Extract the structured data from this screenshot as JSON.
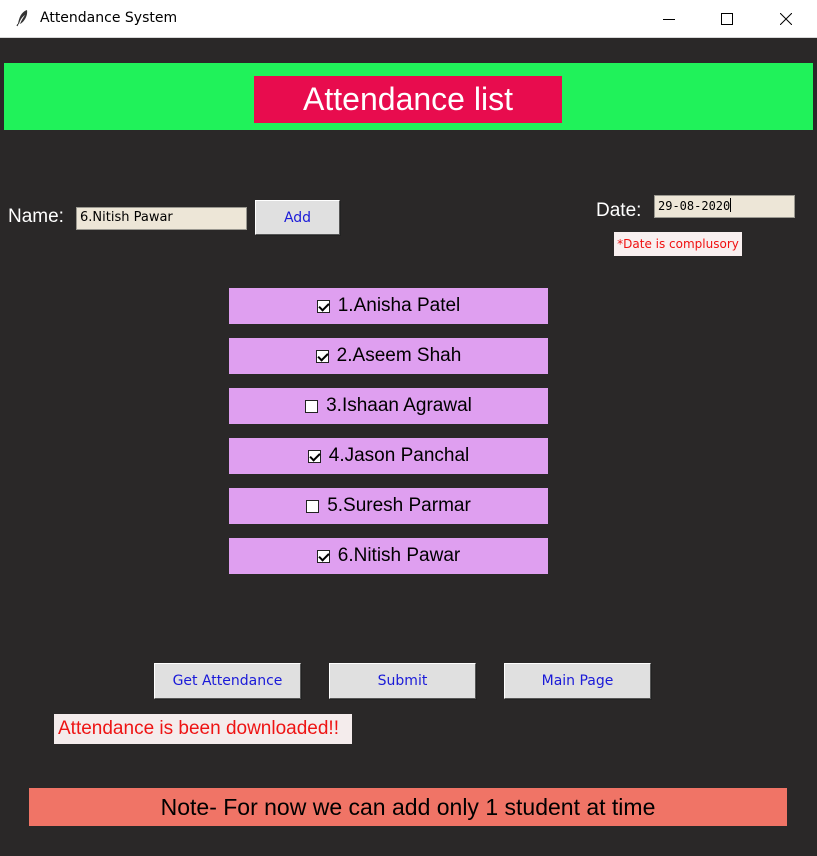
{
  "window": {
    "title": "Attendance System",
    "icon": "feather-icon"
  },
  "header": {
    "title": "Attendance list"
  },
  "name_field": {
    "label": "Name:",
    "value": "6.Nitish Pawar"
  },
  "add_button": {
    "label": "Add"
  },
  "date_field": {
    "label": "Date:",
    "value": "29-08-2020",
    "hint": "*Date is complusory"
  },
  "students": [
    {
      "label": "1.Anisha Patel",
      "checked": true
    },
    {
      "label": "2.Aseem Shah",
      "checked": true
    },
    {
      "label": "3.Ishaan Agrawal",
      "checked": false
    },
    {
      "label": "4.Jason Panchal",
      "checked": true
    },
    {
      "label": "5.Suresh Parmar",
      "checked": false
    },
    {
      "label": "6.Nitish Pawar",
      "checked": true
    }
  ],
  "actions": {
    "get_attendance": "Get Attendance",
    "submit": "Submit",
    "main_page": "Main Page"
  },
  "status_message": "Attendance is been downloaded!!",
  "note": "Note- For now we can add only 1 student at time",
  "colors": {
    "background": "#2a2828",
    "banner": "#20f25a",
    "title_box": "#e80c4e",
    "student_row": "#df9ff0",
    "note_bar": "#f07466",
    "button_text": "#1a1ad8",
    "error_text": "#ee1414"
  }
}
